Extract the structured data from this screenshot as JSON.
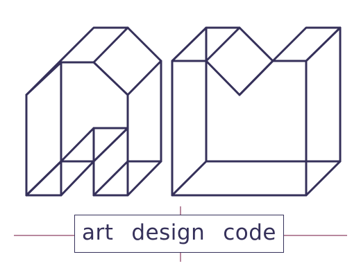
{
  "tagline": {
    "words": [
      "art",
      "design",
      "code"
    ]
  },
  "colors": {
    "ink": "#35305a",
    "guide_line": "#a0607e",
    "background": "#ffffff"
  },
  "logo": {
    "description_icon": "isometric-am-monogram-icon"
  }
}
